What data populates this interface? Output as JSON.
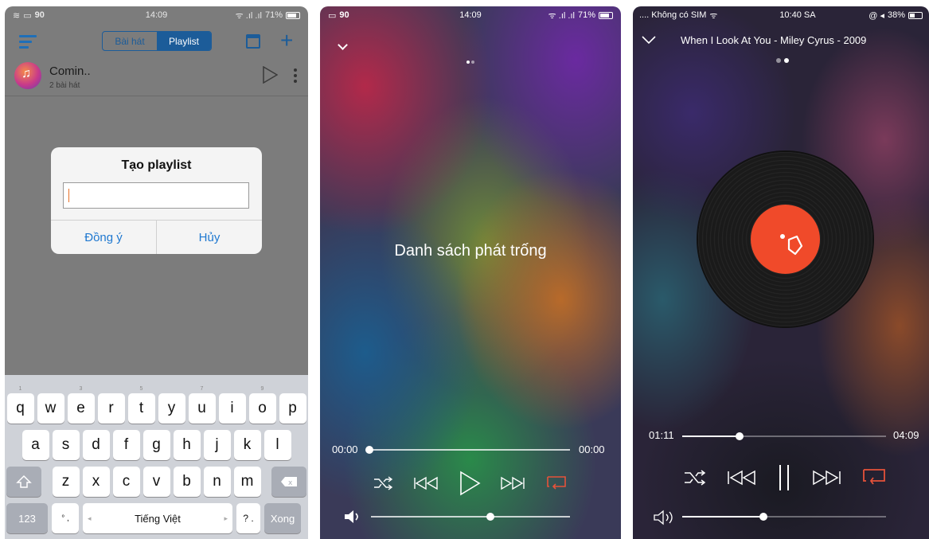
{
  "phone1": {
    "status": {
      "left": "90",
      "time": "14:09",
      "battery": "71%"
    },
    "tabs": [
      {
        "label": "Bài hát"
      },
      {
        "label": "Playlist"
      }
    ],
    "playlist_row": {
      "title": "Comin..",
      "subtitle": "2 bài hát"
    },
    "dialog": {
      "title": "Tạo playlist",
      "input_value": "",
      "confirm": "Đồng ý",
      "cancel": "Hủy"
    },
    "keyboard": {
      "row1": [
        "q",
        "w",
        "e",
        "r",
        "t",
        "y",
        "u",
        "i",
        "o",
        "p"
      ],
      "row1_hints": [
        "1",
        "",
        "3",
        "",
        "5",
        "",
        "7",
        "",
        "9",
        ""
      ],
      "row2": [
        "a",
        "s",
        "d",
        "f",
        "g",
        "h",
        "j",
        "k",
        "l"
      ],
      "row3": [
        "z",
        "x",
        "c",
        "v",
        "b",
        "n",
        "m"
      ],
      "numbers_key": "123",
      "space_label": "Tiếng Việt",
      "done_key": "Xong"
    }
  },
  "phone2": {
    "status": {
      "left": "90",
      "time": "14:09",
      "battery": "71%"
    },
    "empty_message": "Danh sách phát trống",
    "elapsed": "00:00",
    "duration": "00:00",
    "progress": 0,
    "volume": 0.6,
    "accent_color": "#e5523a"
  },
  "phone3": {
    "status": {
      "carrier": ".... Không có SIM",
      "time": "10:40 SA",
      "battery": "38%"
    },
    "song_title": "When I Look At You - Miley Cyrus - 2009",
    "elapsed": "01:11",
    "duration": "04:09",
    "progress": 0.28,
    "volume": 0.4,
    "vinyl_label_color": "#f04a2a",
    "accent_color": "#e5523a"
  }
}
